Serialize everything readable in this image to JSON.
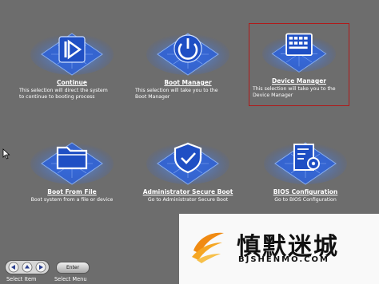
{
  "tiles": [
    {
      "title": "Continue",
      "desc": "This selection will direct the system\nto continue to booting process",
      "icon": "play-icon",
      "selected": false
    },
    {
      "title": "Boot Manager",
      "desc": "This selection will take you to the\nBoot Manager",
      "icon": "power-icon",
      "selected": false
    },
    {
      "title": "Device Manager",
      "desc": "This selection will take you to the\nDevice Manager",
      "icon": "device-chip-icon",
      "selected": true
    },
    {
      "title": "Boot From File",
      "desc": "Boot system from a file or device",
      "icon": "folder-icon",
      "selected": false
    },
    {
      "title": "Administrator Secure Boot",
      "desc": "Go to Administrator Secure Boot",
      "icon": "shield-check-icon",
      "selected": false
    },
    {
      "title": "BIOS Configuration",
      "desc": "Go to BIOS Configuration",
      "icon": "settings-document-icon",
      "selected": false
    }
  ],
  "footer": {
    "enter_label": "Enter",
    "select_item": "Select Item",
    "select_menu": "Select Menu"
  },
  "watermark": {
    "chinese_text": "慎默迷城",
    "english_text": "BJSHENMO.COM"
  },
  "colors": {
    "background": "#6d6d6d",
    "tile_glow": "#3f7fff",
    "selection_border": "#b01a1a",
    "text": "#ffffff"
  }
}
